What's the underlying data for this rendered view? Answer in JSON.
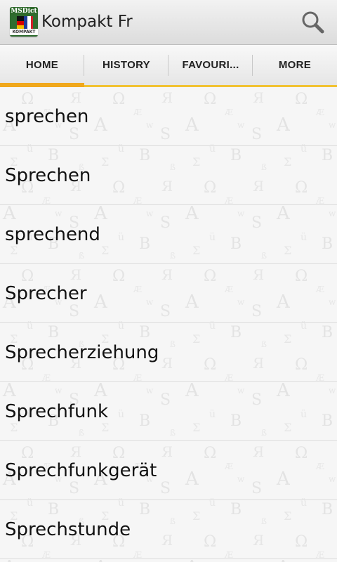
{
  "app": {
    "title": "Kompakt Fr",
    "icon_brand": "MSDict",
    "icon_caption": "KOMPAKT"
  },
  "action_bar": {
    "search_icon": "search-icon"
  },
  "tabs": [
    {
      "label": "HOME",
      "active": true
    },
    {
      "label": "HISTORY",
      "active": false
    },
    {
      "label": "FAVOURI...",
      "active": false
    },
    {
      "label": "MORE",
      "active": false
    }
  ],
  "words": [
    "sprechen",
    "Sprechen",
    "sprechend",
    "Sprecher",
    "Sprecherziehung",
    "Sprechfunk",
    "Sprechfunkgerät",
    "Sprechstunde"
  ],
  "colors": {
    "accent": "#f0a81c",
    "tab_underline": "#f1c232"
  }
}
